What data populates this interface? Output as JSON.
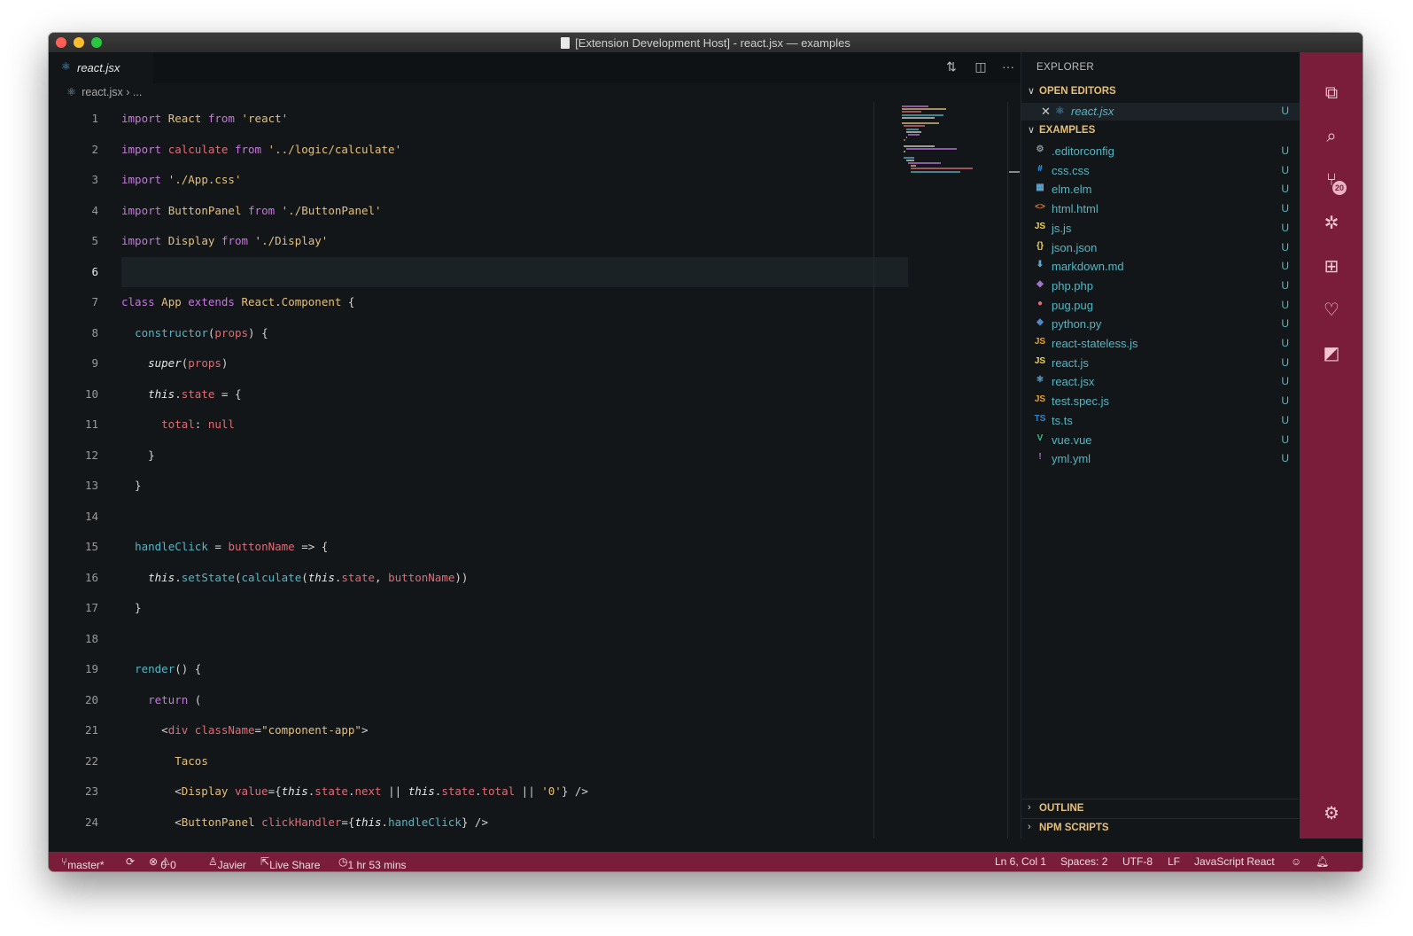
{
  "window": {
    "title": "[Extension Development Host] - react.jsx — examples"
  },
  "tab": {
    "label": "react.jsx"
  },
  "breadcrumb": {
    "file": "react.jsx",
    "sep": "›",
    "rest": "..."
  },
  "code_lines": [
    {
      "n": "1",
      "t": "import React from 'react'"
    },
    {
      "n": "2",
      "t": "import calculate from '../logic/calculate'"
    },
    {
      "n": "3",
      "t": "import './App.css'"
    },
    {
      "n": "4",
      "t": "import ButtonPanel from './ButtonPanel'"
    },
    {
      "n": "5",
      "t": "import Display from './Display'"
    },
    {
      "n": "6",
      "t": ""
    },
    {
      "n": "7",
      "t": "class App extends React.Component {"
    },
    {
      "n": "8",
      "t": "  constructor(props) {"
    },
    {
      "n": "9",
      "t": "    super(props)"
    },
    {
      "n": "10",
      "t": "    this.state = {"
    },
    {
      "n": "11",
      "t": "      total: null"
    },
    {
      "n": "12",
      "t": "    }"
    },
    {
      "n": "13",
      "t": "  }"
    },
    {
      "n": "14",
      "t": ""
    },
    {
      "n": "15",
      "t": "  handleClick = buttonName => {"
    },
    {
      "n": "16",
      "t": "    this.setState(calculate(this.state, buttonName))"
    },
    {
      "n": "17",
      "t": "  }"
    },
    {
      "n": "18",
      "t": ""
    },
    {
      "n": "19",
      "t": "  render() {"
    },
    {
      "n": "20",
      "t": "    return ("
    },
    {
      "n": "21",
      "t": "      <div className=\"component-app\">"
    },
    {
      "n": "22",
      "t": "        Tacos"
    },
    {
      "n": "23",
      "t": "        <Display value={this.state.next || this.state.total || '0'} />"
    },
    {
      "n": "24",
      "t": "        <ButtonPanel clickHandler={this.handleClick} />"
    }
  ],
  "sidebar": {
    "title": "EXPLORER",
    "open_editors": {
      "label": "OPEN EDITORS",
      "file": "react.jsx",
      "badge": "U"
    },
    "examples": {
      "label": "EXAMPLES",
      "files": [
        {
          "name": ".editorconfig",
          "icon": "⚙",
          "color": "#8e9aa3",
          "badge": "U"
        },
        {
          "name": "css.css",
          "icon": "#",
          "color": "#42a5f5",
          "badge": "U"
        },
        {
          "name": "elm.elm",
          "icon": "▦",
          "color": "#5fa8d3",
          "badge": "U"
        },
        {
          "name": "html.html",
          "icon": "<>",
          "color": "#e37933",
          "badge": "U"
        },
        {
          "name": "js.js",
          "icon": "JS",
          "color": "#f0d35b",
          "badge": "U"
        },
        {
          "name": "json.json",
          "icon": "{}",
          "color": "#f0d35b",
          "badge": "U"
        },
        {
          "name": "markdown.md",
          "icon": "⬇",
          "color": "#5fa8d3",
          "badge": "U"
        },
        {
          "name": "php.php",
          "icon": "◆",
          "color": "#a074c4",
          "badge": "U"
        },
        {
          "name": "pug.pug",
          "icon": "●",
          "color": "#e06c75",
          "badge": "U"
        },
        {
          "name": "python.py",
          "icon": "◆",
          "color": "#4e8ac8",
          "badge": "U"
        },
        {
          "name": "react-stateless.js",
          "icon": "JS",
          "color": "#e5a330",
          "badge": "U"
        },
        {
          "name": "react.js",
          "icon": "JS",
          "color": "#f0d35b",
          "badge": "U"
        },
        {
          "name": "react.jsx",
          "icon": "⚛",
          "color": "#5fa8d3",
          "badge": "U"
        },
        {
          "name": "test.spec.js",
          "icon": "JS",
          "color": "#e5a330",
          "badge": "U"
        },
        {
          "name": "ts.ts",
          "icon": "TS",
          "color": "#3b82c4",
          "badge": "U"
        },
        {
          "name": "vue.vue",
          "icon": "V",
          "color": "#42b883",
          "badge": "U"
        },
        {
          "name": "yml.yml",
          "icon": "!",
          "color": "#a074c4",
          "badge": "U"
        }
      ]
    },
    "outline": "OUTLINE",
    "npm_scripts": "NPM SCRIPTS"
  },
  "activity_bar": {
    "items": [
      "explorer-icon",
      "search-icon",
      "source-control-icon",
      "debug-icon",
      "extensions-icon",
      "live-share-icon",
      "remote-icon"
    ],
    "scm_badge": "20",
    "settings": "gear-icon"
  },
  "statusbar": {
    "branch": "master*",
    "errors": "0",
    "warnings": "0",
    "user": "Javier",
    "live_share": "Live Share",
    "time": "1 hr 53 mins",
    "position": "Ln 6, Col 1",
    "spaces": "Spaces: 2",
    "encoding": "UTF-8",
    "eol": "LF",
    "language": "JavaScript React"
  }
}
